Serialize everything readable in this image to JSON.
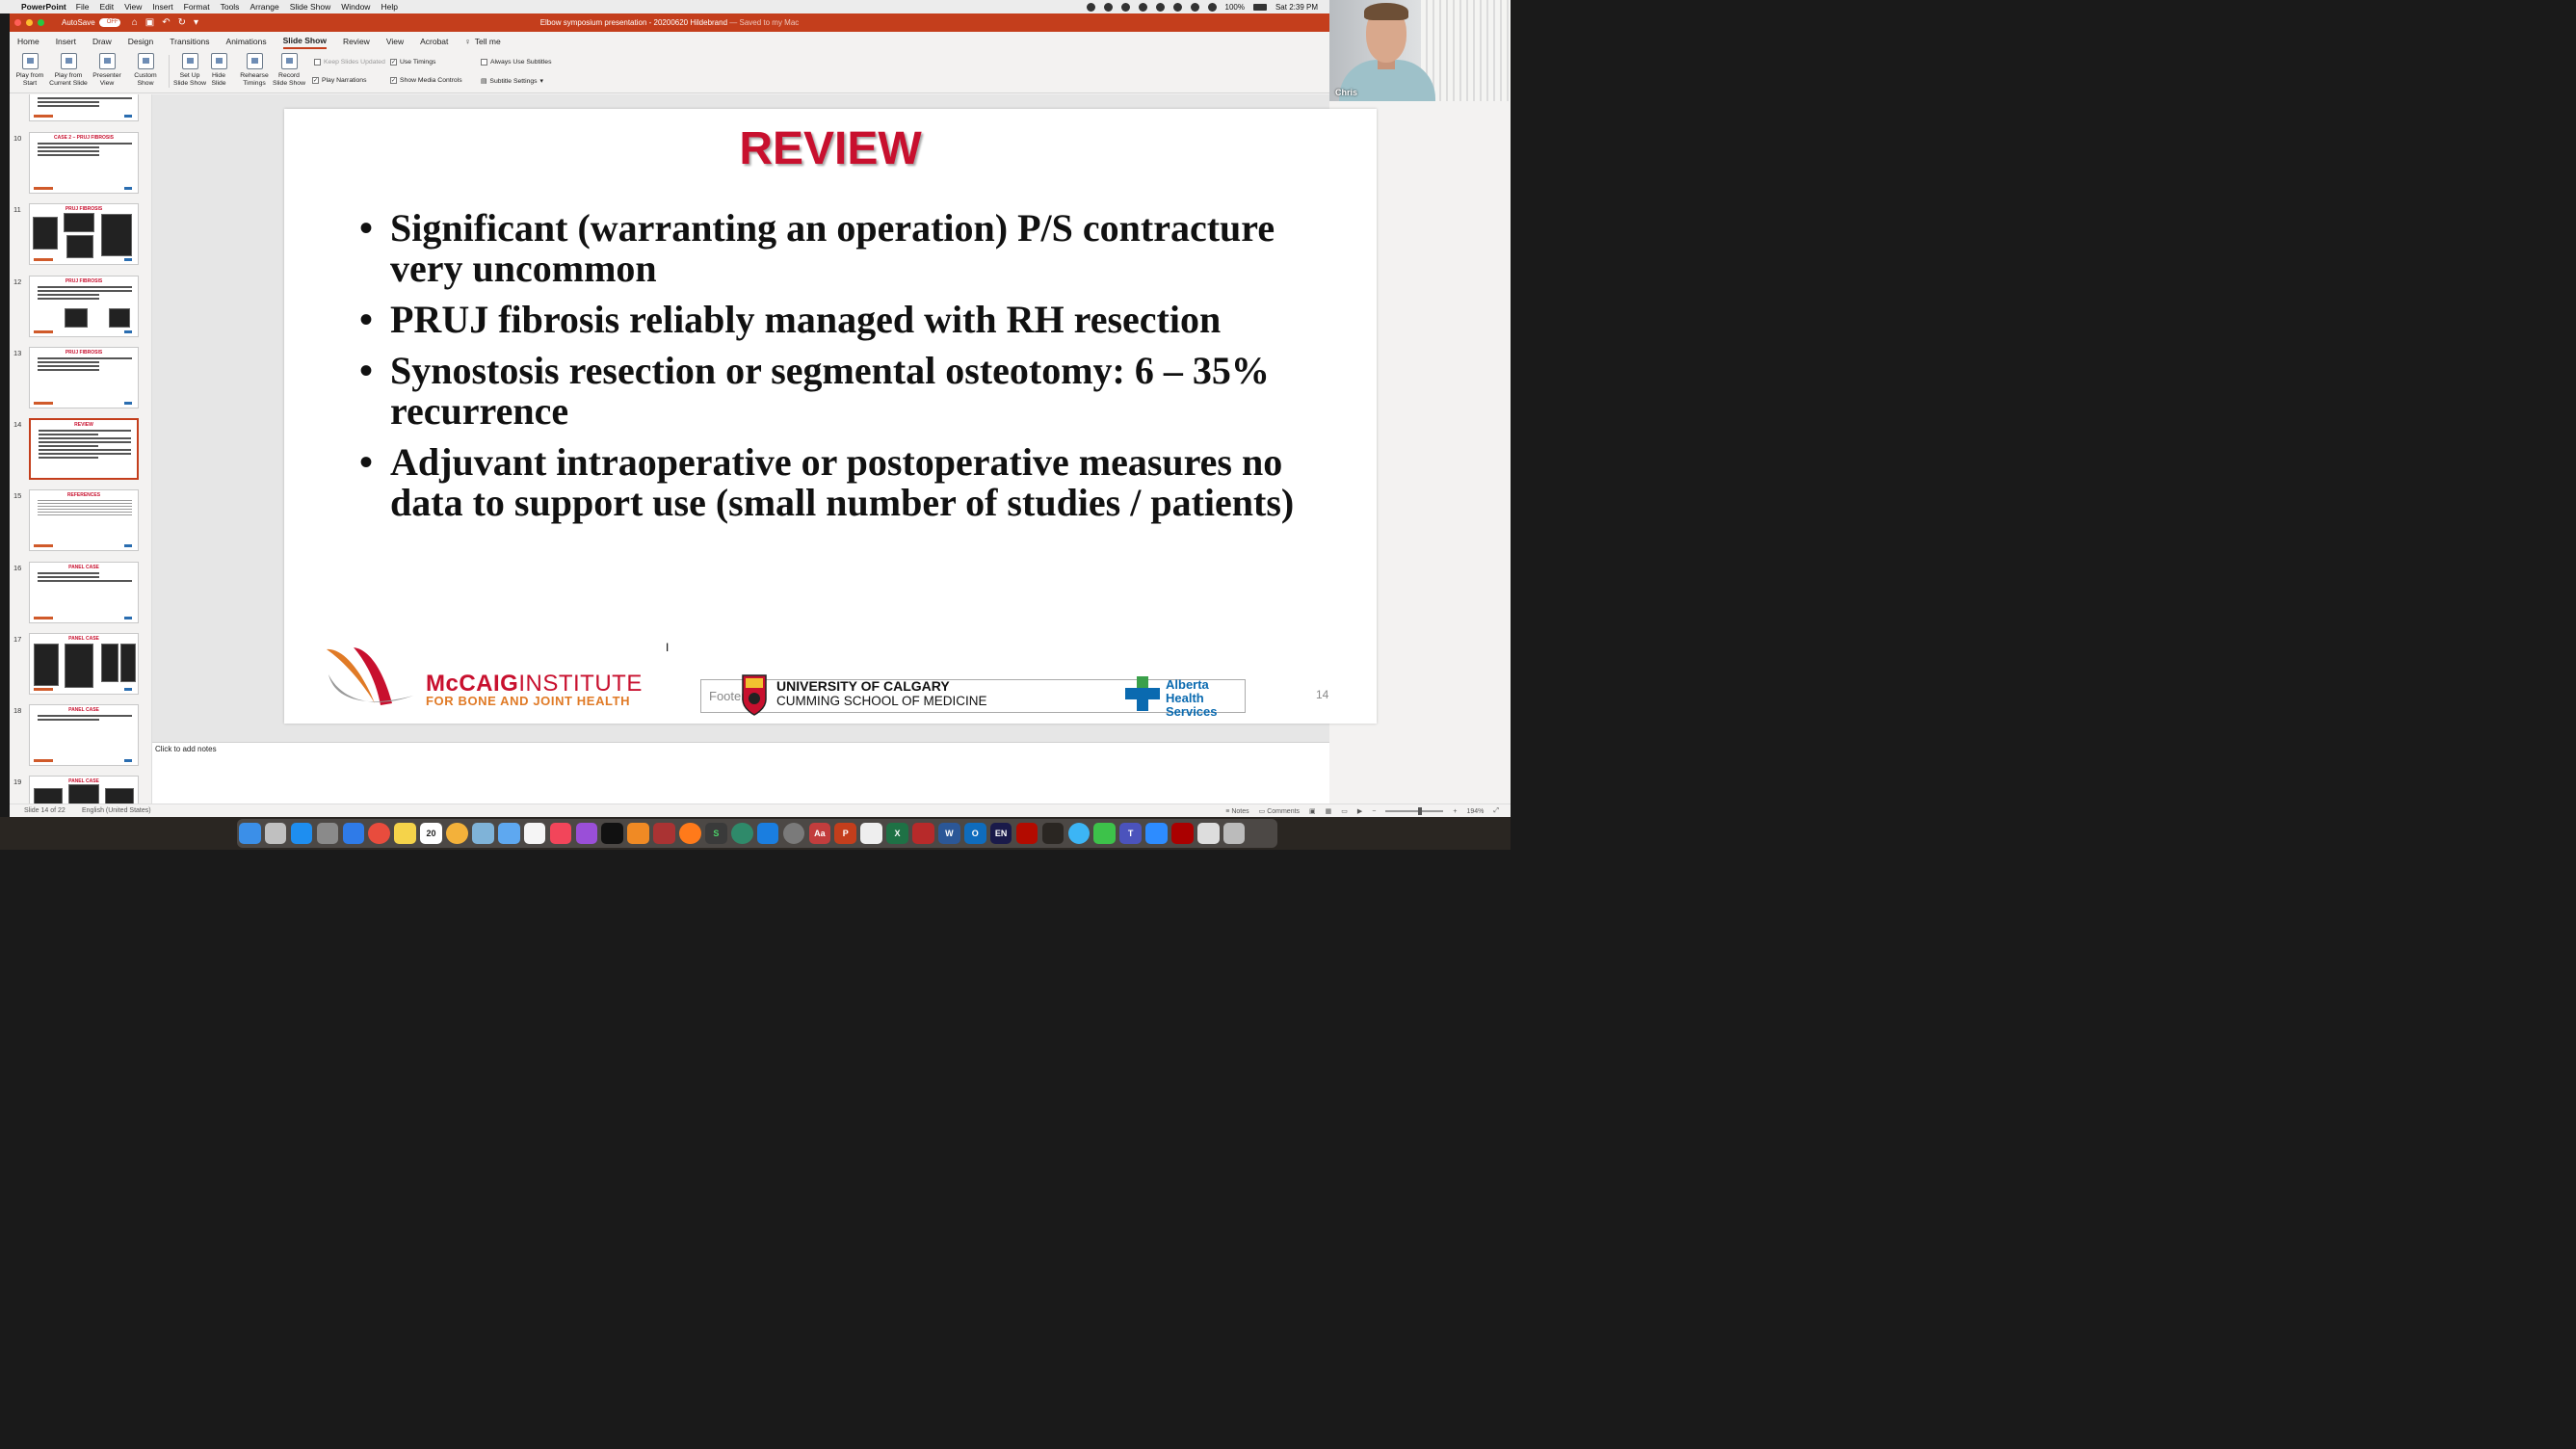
{
  "menubar": {
    "app": "PowerPoint",
    "items": [
      "File",
      "Edit",
      "View",
      "Insert",
      "Format",
      "Tools",
      "Arrange",
      "Slide Show",
      "Window",
      "Help"
    ],
    "battery": "100%",
    "clock": "Sat 2:39 PM"
  },
  "titlebar": {
    "autosave": "AutoSave",
    "autosave_state": "OFF",
    "title": "Elbow symposium presentation - 20200620 Hildebrand",
    "saved": "— Saved to my Mac"
  },
  "tabs": [
    "Home",
    "Insert",
    "Draw",
    "Design",
    "Transitions",
    "Animations",
    "Slide Show",
    "Review",
    "View",
    "Acrobat"
  ],
  "active_tab": "Slide Show",
  "tell_me": "Tell me",
  "ribbon": {
    "play_from_start": [
      "Play from",
      "Start"
    ],
    "play_from_current": [
      "Play from",
      "Current Slide"
    ],
    "presenter_view": [
      "Presenter",
      "View"
    ],
    "custom_show": [
      "Custom",
      "Show"
    ],
    "set_up": [
      "Set Up",
      "Slide Show"
    ],
    "hide_slide": [
      "Hide",
      "Slide"
    ],
    "rehearse": [
      "Rehearse",
      "Timings"
    ],
    "record": [
      "Record",
      "Slide Show"
    ],
    "keep_updated": "Keep Slides Updated",
    "play_narrations": "Play Narrations",
    "use_timings": "Use Timings",
    "show_media": "Show Media Controls",
    "always_subtitles": "Always Use Subtitles",
    "subtitle_settings": "Subtitle Settings"
  },
  "thumbnails": [
    {
      "num": "",
      "title": ""
    },
    {
      "num": "10",
      "title": "CASE 2 – PRUJ FIBROSIS"
    },
    {
      "num": "11",
      "title": "PRUJ FIBROSIS"
    },
    {
      "num": "12",
      "title": "PRUJ FIBROSIS"
    },
    {
      "num": "13",
      "title": "PRUJ FIBROSIS"
    },
    {
      "num": "14",
      "title": "REVIEW"
    },
    {
      "num": "15",
      "title": "REFERENCES"
    },
    {
      "num": "16",
      "title": "PANEL CASE"
    },
    {
      "num": "17",
      "title": "PANEL CASE"
    },
    {
      "num": "18",
      "title": "PANEL CASE"
    },
    {
      "num": "19",
      "title": "PANEL CASE"
    }
  ],
  "slide": {
    "title": "REVIEW",
    "bullets": [
      "Significant (warranting an operation) P/S contracture very uncommon",
      "PRUJ fibrosis reliably managed with RH resection",
      "Synostosis resection or segmental osteotomy: 6 – 35% recurrence",
      "Adjuvant intraoperative or postoperative measures no data to support use (small number of studies / patients)"
    ],
    "mccaig_name_bold": "McCAIG",
    "mccaig_name_rest": "INSTITUTE",
    "mccaig_sub": "FOR BONE AND JOINT HEALTH",
    "footer_placeholder": "Footer",
    "uc_name": "UNIVERSITY OF CALGARY",
    "uc_sub": "CUMMING SCHOOL OF MEDICINE",
    "ahs_line1": "Alberta Health",
    "ahs_line2": "Services",
    "number": "14"
  },
  "notes_placeholder": "Click to add notes",
  "status": {
    "slide_of": "Slide 14 of 22",
    "language": "English (United States)",
    "notes": "Notes",
    "comments": "Comments",
    "zoom": "194%"
  },
  "camera": {
    "name": "Chris"
  },
  "colors": {
    "accent": "#c43e1c",
    "title_red": "#c8102e",
    "ahs_blue": "#0a6ab0"
  },
  "dock_icons": [
    "finder",
    "launchpad",
    "app-store",
    "rocket",
    "safari",
    "chrome",
    "notes",
    "calendar",
    "photos",
    "preview",
    "mail",
    "reminders",
    "music",
    "podcasts",
    "tv",
    "books",
    "photo-booth",
    "firefox",
    "scrivener",
    "time-machine",
    "xcode",
    "system-preferences",
    "dictionary",
    "powerpoint",
    "activity",
    "excel",
    "mendeley",
    "word",
    "outlook",
    "language",
    "acrobat",
    "messages",
    "facetime",
    "teams",
    "zoom",
    "pdf",
    "files",
    "trash"
  ]
}
